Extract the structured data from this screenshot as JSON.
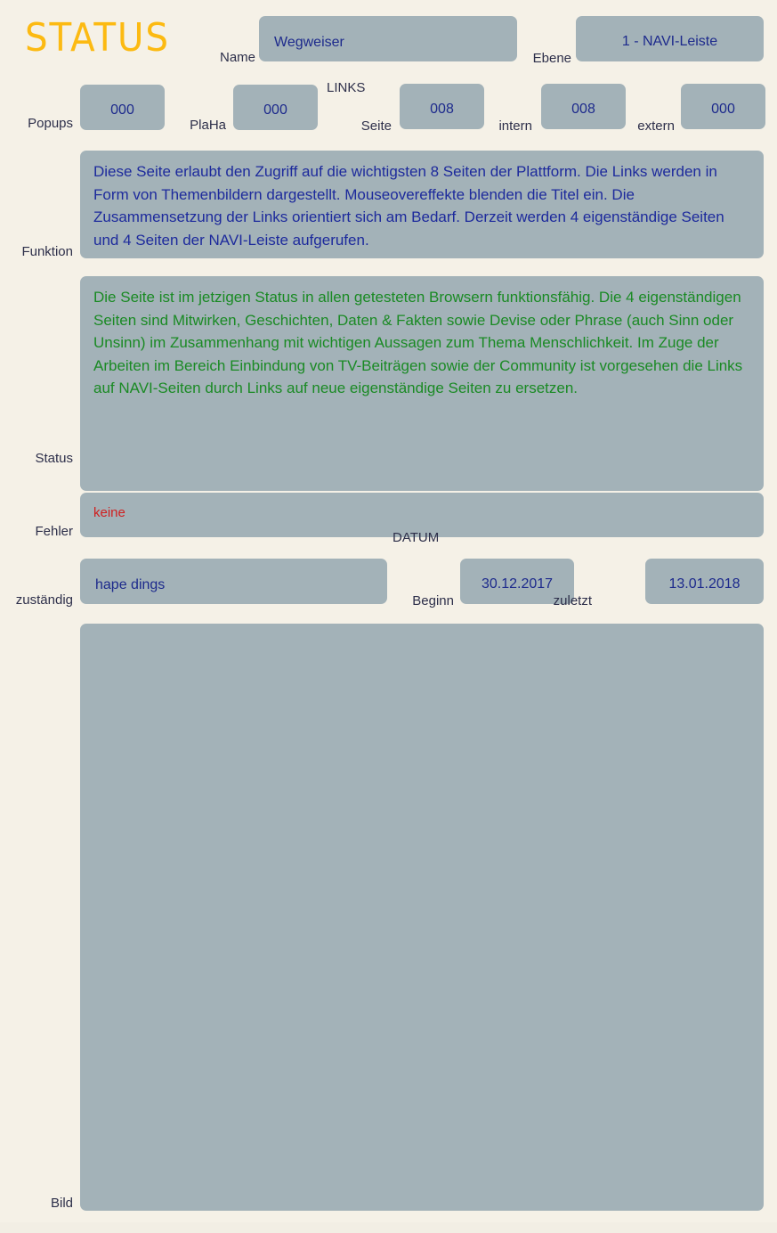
{
  "header": {
    "title": "STATUS",
    "title_color": "#fcba12"
  },
  "theme": {
    "background": "#f5f1e7",
    "panel": "#a3b2b8",
    "label_color": "#2d2f4a",
    "value_blue": "#1d2a8c",
    "text_green": "#1a8a24",
    "text_red": "#cf2020"
  },
  "fields": {
    "name": {
      "label": "Name",
      "value": "Wegweiser"
    },
    "ebene": {
      "label": "Ebene",
      "value": "1 - NAVI-Leiste"
    },
    "popups": {
      "label": "Popups",
      "value": "000"
    },
    "plaha": {
      "label": "PlaHa",
      "value": "000"
    },
    "links_group": {
      "label": "LINKS"
    },
    "seite": {
      "label": "Seite",
      "value": "008"
    },
    "intern": {
      "label": "intern",
      "value": "008"
    },
    "extern": {
      "label": "extern",
      "value": "000"
    },
    "funktion": {
      "label": "Funktion",
      "value": "Diese Seite erlaubt den Zugriff auf die wichtigsten 8 Seiten der Plattform. Die Links werden in Form von Themenbildern dargestellt. Mouseovereffekte blenden die Titel ein. Die Zusammensetzung der Links orientiert sich am Bedarf. Derzeit werden 4 eigenständige Seiten und 4 Seiten der NAVI-Leiste aufgerufen."
    },
    "status": {
      "label": "Status",
      "value": "Die Seite ist im jetzigen Status in allen getesteten Browsern funktionsfähig. Die 4 eigenständigen Seiten sind Mitwirken, Geschichten, Daten & Fakten sowie Devise oder Phrase (auch Sinn oder Unsinn) im Zusammenhang mit wichtigen Aussagen zum Thema Menschlichkeit. Im Zuge der Arbeiten im Bereich Einbindung von TV-Beiträgen sowie der Community ist vorgesehen die Links auf NAVI-Seiten durch Links auf neue eigenständige Seiten zu ersetzen."
    },
    "fehler": {
      "label": "Fehler",
      "value": "keine"
    },
    "zustaendig": {
      "label": "zuständig",
      "value": "hape dings"
    },
    "datum_group": {
      "label": "DATUM"
    },
    "beginn": {
      "label": "Beginn",
      "value": "30.12.2017"
    },
    "zuletzt": {
      "label": "zuletzt",
      "value": "13.01.2018"
    },
    "bild": {
      "label": "Bild",
      "value": ""
    }
  }
}
